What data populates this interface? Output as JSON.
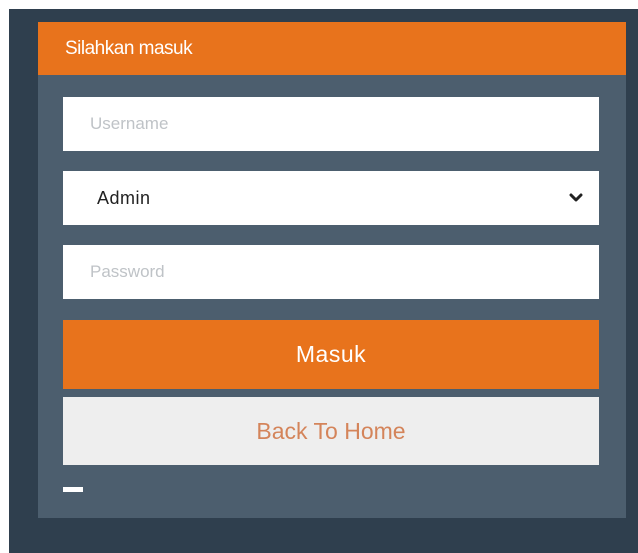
{
  "login": {
    "title": "Silahkan masuk",
    "username": {
      "value": "",
      "placeholder": "Username"
    },
    "role": {
      "selected": "Admin"
    },
    "password": {
      "value": "",
      "placeholder": "Password"
    },
    "submit_label": "Masuk",
    "back_label": "Back To Home"
  },
  "icons": {
    "dropdown": "chevron-down-icon",
    "footer": "minus-icon"
  },
  "colors": {
    "accent": "#e8731c",
    "panel": "#4c5e6e",
    "backdrop": "#2f3f4e",
    "secondary_button": "#eeeeee",
    "secondary_text": "#d4845a"
  }
}
